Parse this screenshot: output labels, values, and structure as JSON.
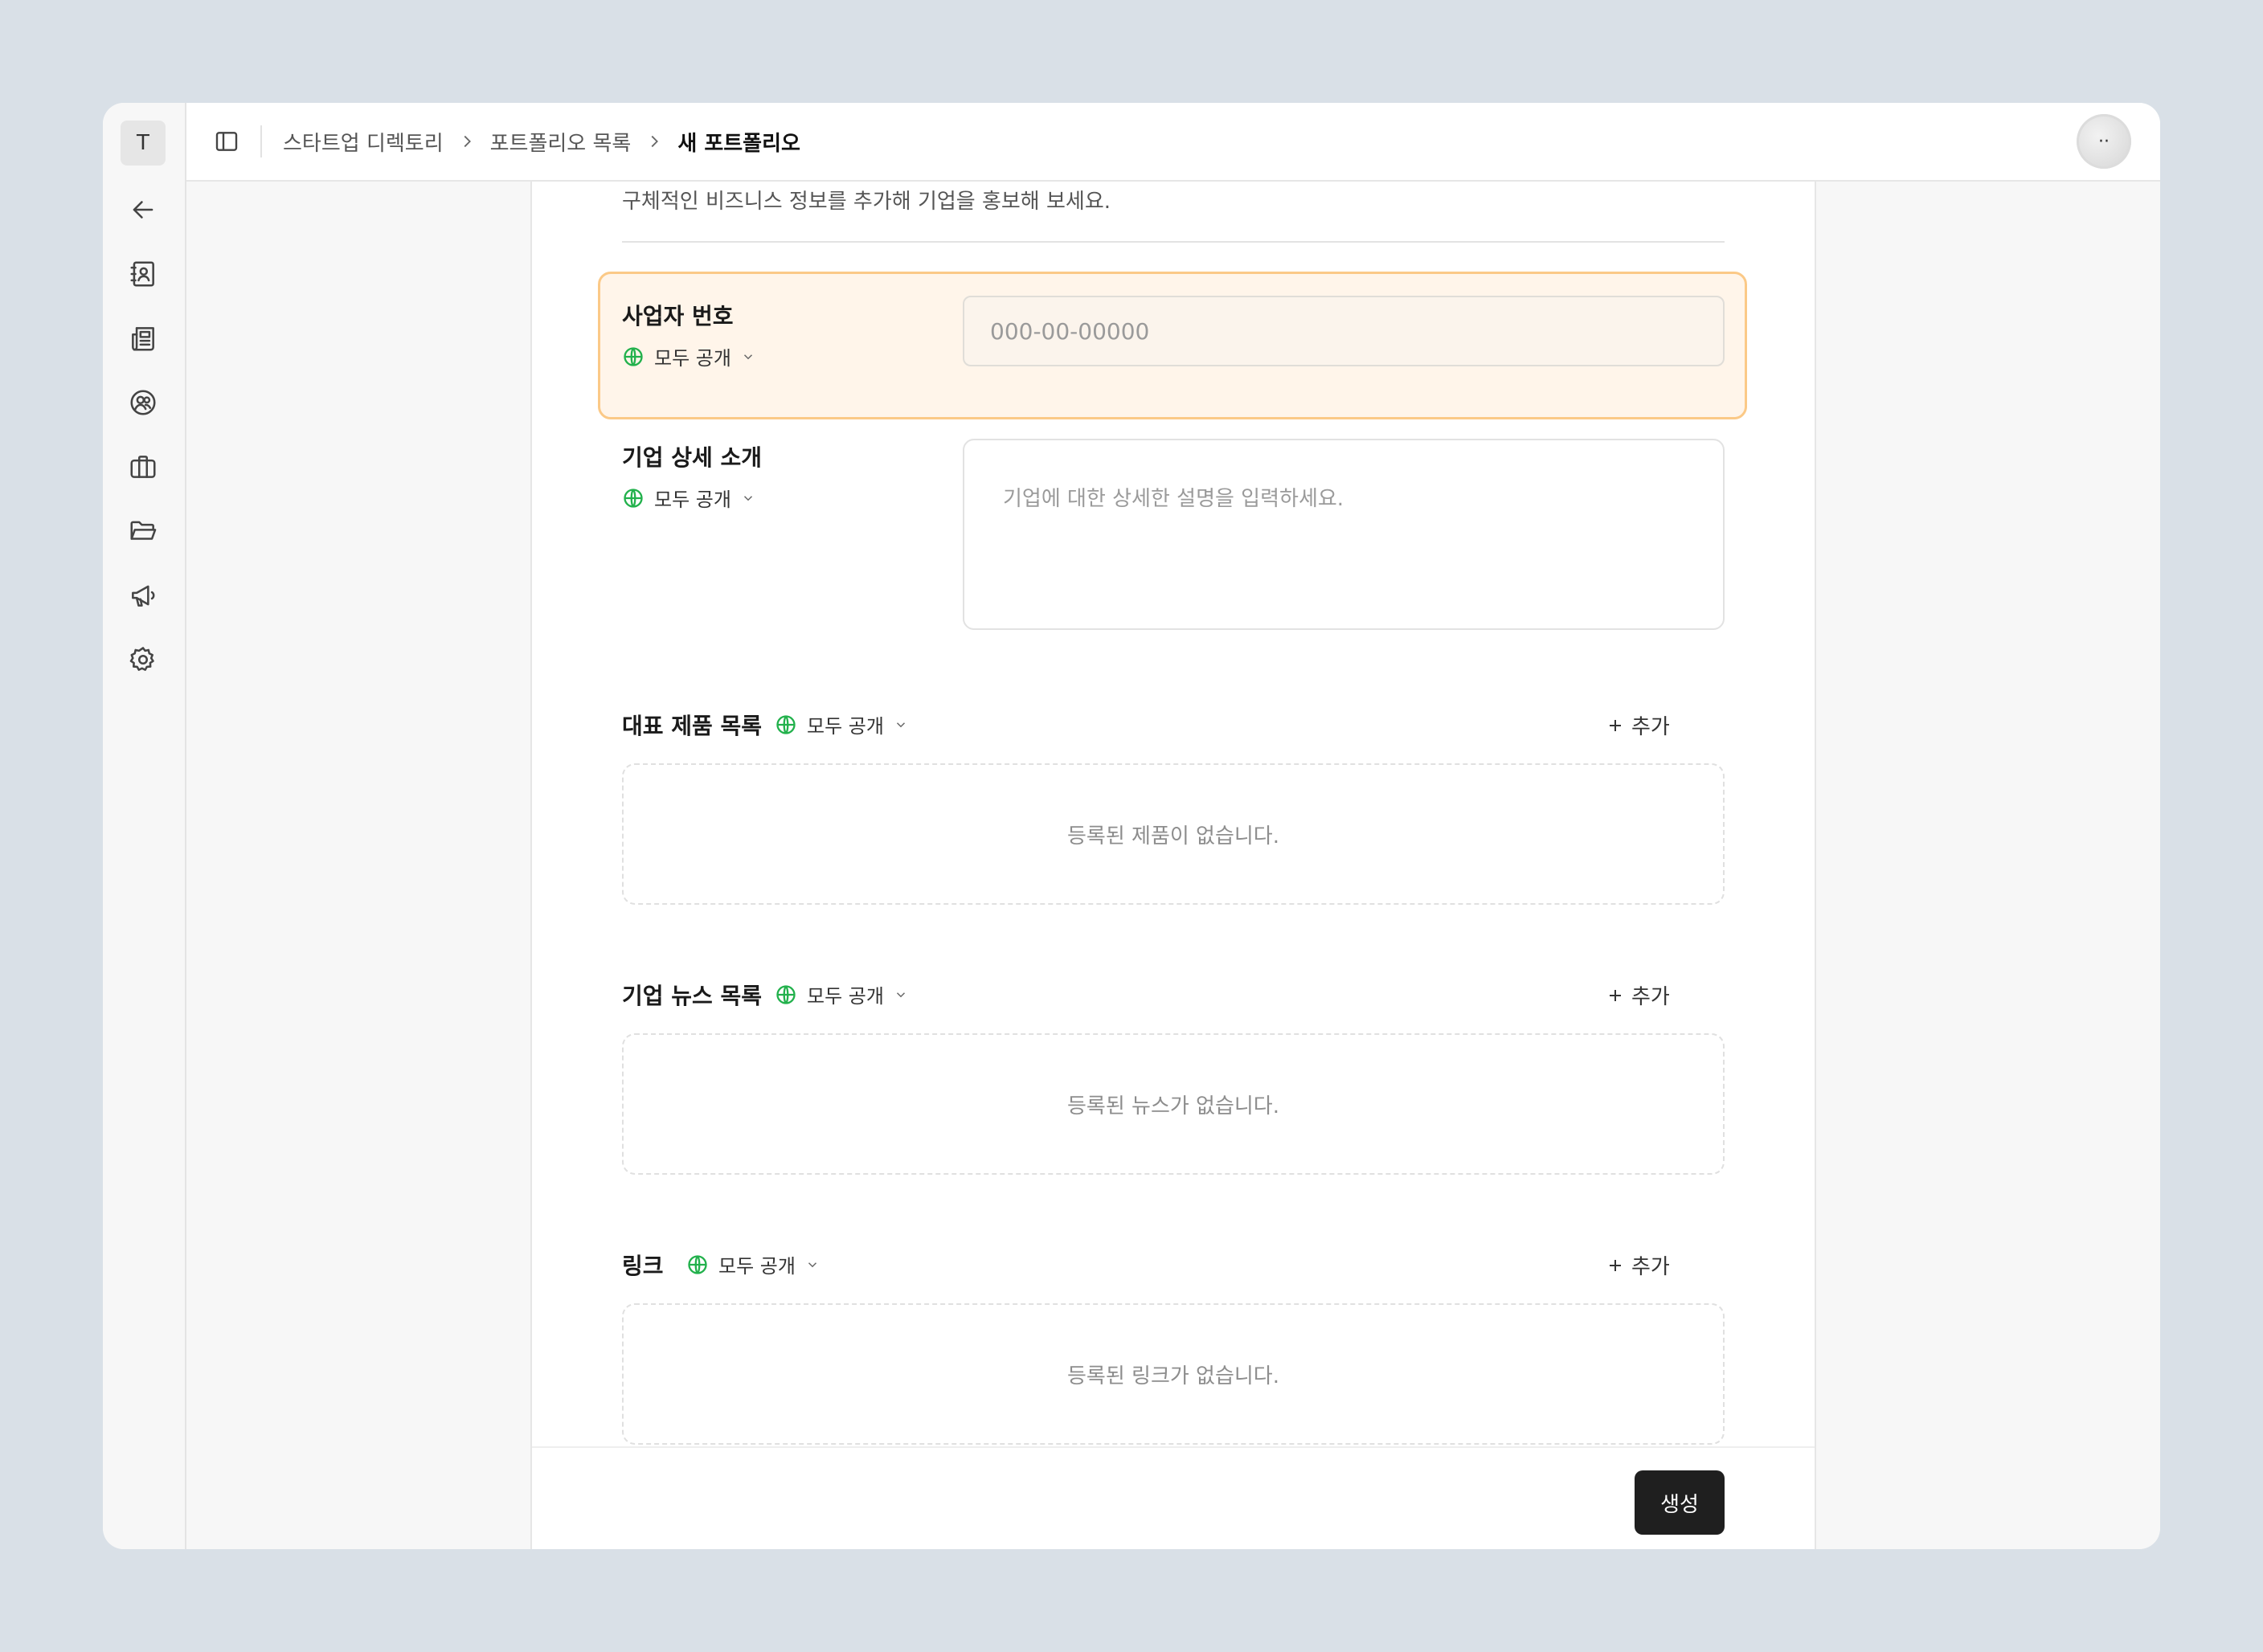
{
  "workspace": {
    "initial": "T"
  },
  "sidebar": {
    "items": [
      {
        "name": "back",
        "icon": "arrow-left-icon"
      },
      {
        "name": "directory",
        "icon": "contact-book-icon"
      },
      {
        "name": "news",
        "icon": "newspaper-icon"
      },
      {
        "name": "community",
        "icon": "users-circle-icon"
      },
      {
        "name": "jobs",
        "icon": "briefcase-icon"
      },
      {
        "name": "files",
        "icon": "folder-open-icon"
      },
      {
        "name": "announcements",
        "icon": "megaphone-icon"
      },
      {
        "name": "settings",
        "icon": "gear-icon"
      }
    ]
  },
  "header": {
    "breadcrumb": [
      "스타트업 디렉토리",
      "포트폴리오 목록",
      "새 포트폴리오"
    ],
    "user_avatar_text": "··"
  },
  "form": {
    "description": "구체적인 비즈니스 정보를 추가해 기업을 홍보해 보세요.",
    "business_number": {
      "label": "사업자 번호",
      "visibility": "모두 공개",
      "placeholder": "000-00-00000",
      "value": ""
    },
    "company_detail": {
      "label": "기업 상세 소개",
      "visibility": "모두 공개",
      "placeholder": "기업에 대한 상세한 설명을 입력하세요."
    },
    "products": {
      "label": "대표 제품 목록",
      "visibility": "모두 공개",
      "add_label": "추가",
      "empty_text": "등록된 제품이 없습니다."
    },
    "news": {
      "label": "기업 뉴스 목록",
      "visibility": "모두 공개",
      "add_label": "추가",
      "empty_text": "등록된 뉴스가 없습니다."
    },
    "links": {
      "label": "링크",
      "visibility": "모두 공개",
      "add_label": "추가",
      "empty_text": "등록된 링크가 없습니다."
    },
    "submit_label": "생성"
  },
  "colors": {
    "highlight_bg": "#fff5ea",
    "highlight_border": "#fbc987",
    "globe": "#22b14c",
    "primary_button": "#1f1f1f"
  }
}
